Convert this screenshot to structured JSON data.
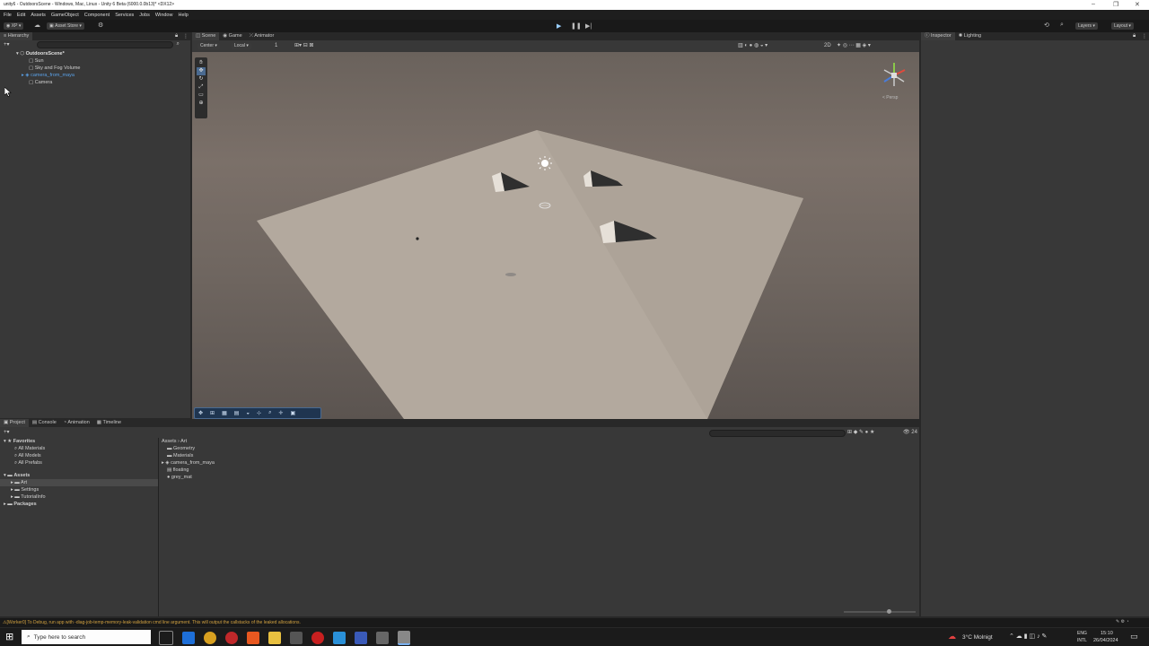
{
  "titlebar": {
    "title": "unity6 - OutdoorsScene - Windows, Mac, Linux - Unity 6 Beta (6000.0.0b13)* <DX12>"
  },
  "menu": [
    "File",
    "Edit",
    "Assets",
    "GameObject",
    "Component",
    "Services",
    "Jobs",
    "Window",
    "Help"
  ],
  "toolbar": {
    "account": "XP",
    "asset_store": "Asset Store",
    "layers": "Layers",
    "layout": "Layout"
  },
  "hierarchy": {
    "tab": "Hierarchy",
    "scene": "OutdoorsScene*",
    "items": [
      "Sun",
      "Sky and Fog Volume",
      "camera_from_maya",
      "Camera"
    ]
  },
  "scene_view": {
    "tabs": [
      "Scene",
      "Game",
      "Animator"
    ],
    "pivot": "Center",
    "space": "Local",
    "grid_value": "1",
    "persp": "< Persp",
    "mode_2d": "2D"
  },
  "inspector": {
    "tabs": [
      "Inspector",
      "Lighting"
    ]
  },
  "project": {
    "tabs": [
      "Project",
      "Console",
      "Animation",
      "Timeline"
    ],
    "favorites_label": "Favorites",
    "favorites": [
      "All Materials",
      "All Models",
      "All Prefabs"
    ],
    "assets_label": "Assets",
    "assets_children": [
      "Art",
      "Settings",
      "TutorialInfo"
    ],
    "packages_label": "Packages",
    "breadcrumb": [
      "Assets",
      "Art"
    ],
    "files": [
      "Geometry",
      "Materials",
      "camera_from_maya",
      "floating",
      "grey_mat"
    ],
    "count": "24"
  },
  "status": {
    "message": "[Worker0] To Debug, run app with -diag-job-temp-memory-leak-validation cmd line argument. This will output the callstacks of the leaked allocations."
  },
  "taskbar": {
    "search_placeholder": "Type here to search",
    "weather": "3°C  Molnigt",
    "lang": "ENG",
    "lang_sub": "INTL",
    "time": "15:10",
    "date": "26/04/2024"
  },
  "colors": {
    "accent_blue": "#5aa0e6",
    "warning": "#d0a040",
    "panel": "#383838"
  }
}
